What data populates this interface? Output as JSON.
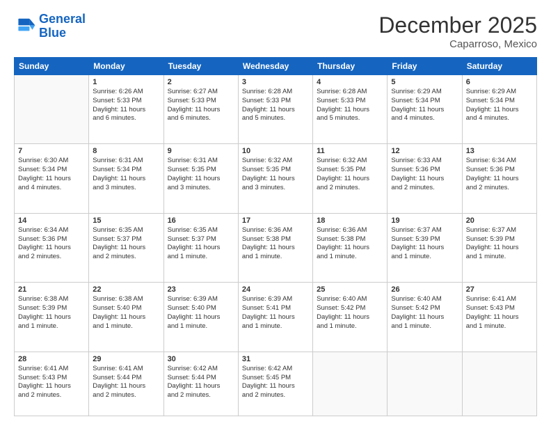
{
  "header": {
    "logo_line1": "General",
    "logo_line2": "Blue",
    "month_title": "December 2025",
    "location": "Caparroso, Mexico"
  },
  "weekdays": [
    "Sunday",
    "Monday",
    "Tuesday",
    "Wednesday",
    "Thursday",
    "Friday",
    "Saturday"
  ],
  "weeks": [
    [
      {
        "day": "",
        "info": ""
      },
      {
        "day": "1",
        "info": "Sunrise: 6:26 AM\nSunset: 5:33 PM\nDaylight: 11 hours\nand 6 minutes."
      },
      {
        "day": "2",
        "info": "Sunrise: 6:27 AM\nSunset: 5:33 PM\nDaylight: 11 hours\nand 6 minutes."
      },
      {
        "day": "3",
        "info": "Sunrise: 6:28 AM\nSunset: 5:33 PM\nDaylight: 11 hours\nand 5 minutes."
      },
      {
        "day": "4",
        "info": "Sunrise: 6:28 AM\nSunset: 5:33 PM\nDaylight: 11 hours\nand 5 minutes."
      },
      {
        "day": "5",
        "info": "Sunrise: 6:29 AM\nSunset: 5:34 PM\nDaylight: 11 hours\nand 4 minutes."
      },
      {
        "day": "6",
        "info": "Sunrise: 6:29 AM\nSunset: 5:34 PM\nDaylight: 11 hours\nand 4 minutes."
      }
    ],
    [
      {
        "day": "7",
        "info": "Sunrise: 6:30 AM\nSunset: 5:34 PM\nDaylight: 11 hours\nand 4 minutes."
      },
      {
        "day": "8",
        "info": "Sunrise: 6:31 AM\nSunset: 5:34 PM\nDaylight: 11 hours\nand 3 minutes."
      },
      {
        "day": "9",
        "info": "Sunrise: 6:31 AM\nSunset: 5:35 PM\nDaylight: 11 hours\nand 3 minutes."
      },
      {
        "day": "10",
        "info": "Sunrise: 6:32 AM\nSunset: 5:35 PM\nDaylight: 11 hours\nand 3 minutes."
      },
      {
        "day": "11",
        "info": "Sunrise: 6:32 AM\nSunset: 5:35 PM\nDaylight: 11 hours\nand 2 minutes."
      },
      {
        "day": "12",
        "info": "Sunrise: 6:33 AM\nSunset: 5:36 PM\nDaylight: 11 hours\nand 2 minutes."
      },
      {
        "day": "13",
        "info": "Sunrise: 6:34 AM\nSunset: 5:36 PM\nDaylight: 11 hours\nand 2 minutes."
      }
    ],
    [
      {
        "day": "14",
        "info": "Sunrise: 6:34 AM\nSunset: 5:36 PM\nDaylight: 11 hours\nand 2 minutes."
      },
      {
        "day": "15",
        "info": "Sunrise: 6:35 AM\nSunset: 5:37 PM\nDaylight: 11 hours\nand 2 minutes."
      },
      {
        "day": "16",
        "info": "Sunrise: 6:35 AM\nSunset: 5:37 PM\nDaylight: 11 hours\nand 1 minute."
      },
      {
        "day": "17",
        "info": "Sunrise: 6:36 AM\nSunset: 5:38 PM\nDaylight: 11 hours\nand 1 minute."
      },
      {
        "day": "18",
        "info": "Sunrise: 6:36 AM\nSunset: 5:38 PM\nDaylight: 11 hours\nand 1 minute."
      },
      {
        "day": "19",
        "info": "Sunrise: 6:37 AM\nSunset: 5:39 PM\nDaylight: 11 hours\nand 1 minute."
      },
      {
        "day": "20",
        "info": "Sunrise: 6:37 AM\nSunset: 5:39 PM\nDaylight: 11 hours\nand 1 minute."
      }
    ],
    [
      {
        "day": "21",
        "info": "Sunrise: 6:38 AM\nSunset: 5:39 PM\nDaylight: 11 hours\nand 1 minute."
      },
      {
        "day": "22",
        "info": "Sunrise: 6:38 AM\nSunset: 5:40 PM\nDaylight: 11 hours\nand 1 minute."
      },
      {
        "day": "23",
        "info": "Sunrise: 6:39 AM\nSunset: 5:40 PM\nDaylight: 11 hours\nand 1 minute."
      },
      {
        "day": "24",
        "info": "Sunrise: 6:39 AM\nSunset: 5:41 PM\nDaylight: 11 hours\nand 1 minute."
      },
      {
        "day": "25",
        "info": "Sunrise: 6:40 AM\nSunset: 5:42 PM\nDaylight: 11 hours\nand 1 minute."
      },
      {
        "day": "26",
        "info": "Sunrise: 6:40 AM\nSunset: 5:42 PM\nDaylight: 11 hours\nand 1 minute."
      },
      {
        "day": "27",
        "info": "Sunrise: 6:41 AM\nSunset: 5:43 PM\nDaylight: 11 hours\nand 1 minute."
      }
    ],
    [
      {
        "day": "28",
        "info": "Sunrise: 6:41 AM\nSunset: 5:43 PM\nDaylight: 11 hours\nand 2 minutes."
      },
      {
        "day": "29",
        "info": "Sunrise: 6:41 AM\nSunset: 5:44 PM\nDaylight: 11 hours\nand 2 minutes."
      },
      {
        "day": "30",
        "info": "Sunrise: 6:42 AM\nSunset: 5:44 PM\nDaylight: 11 hours\nand 2 minutes."
      },
      {
        "day": "31",
        "info": "Sunrise: 6:42 AM\nSunset: 5:45 PM\nDaylight: 11 hours\nand 2 minutes."
      },
      {
        "day": "",
        "info": ""
      },
      {
        "day": "",
        "info": ""
      },
      {
        "day": "",
        "info": ""
      }
    ]
  ]
}
